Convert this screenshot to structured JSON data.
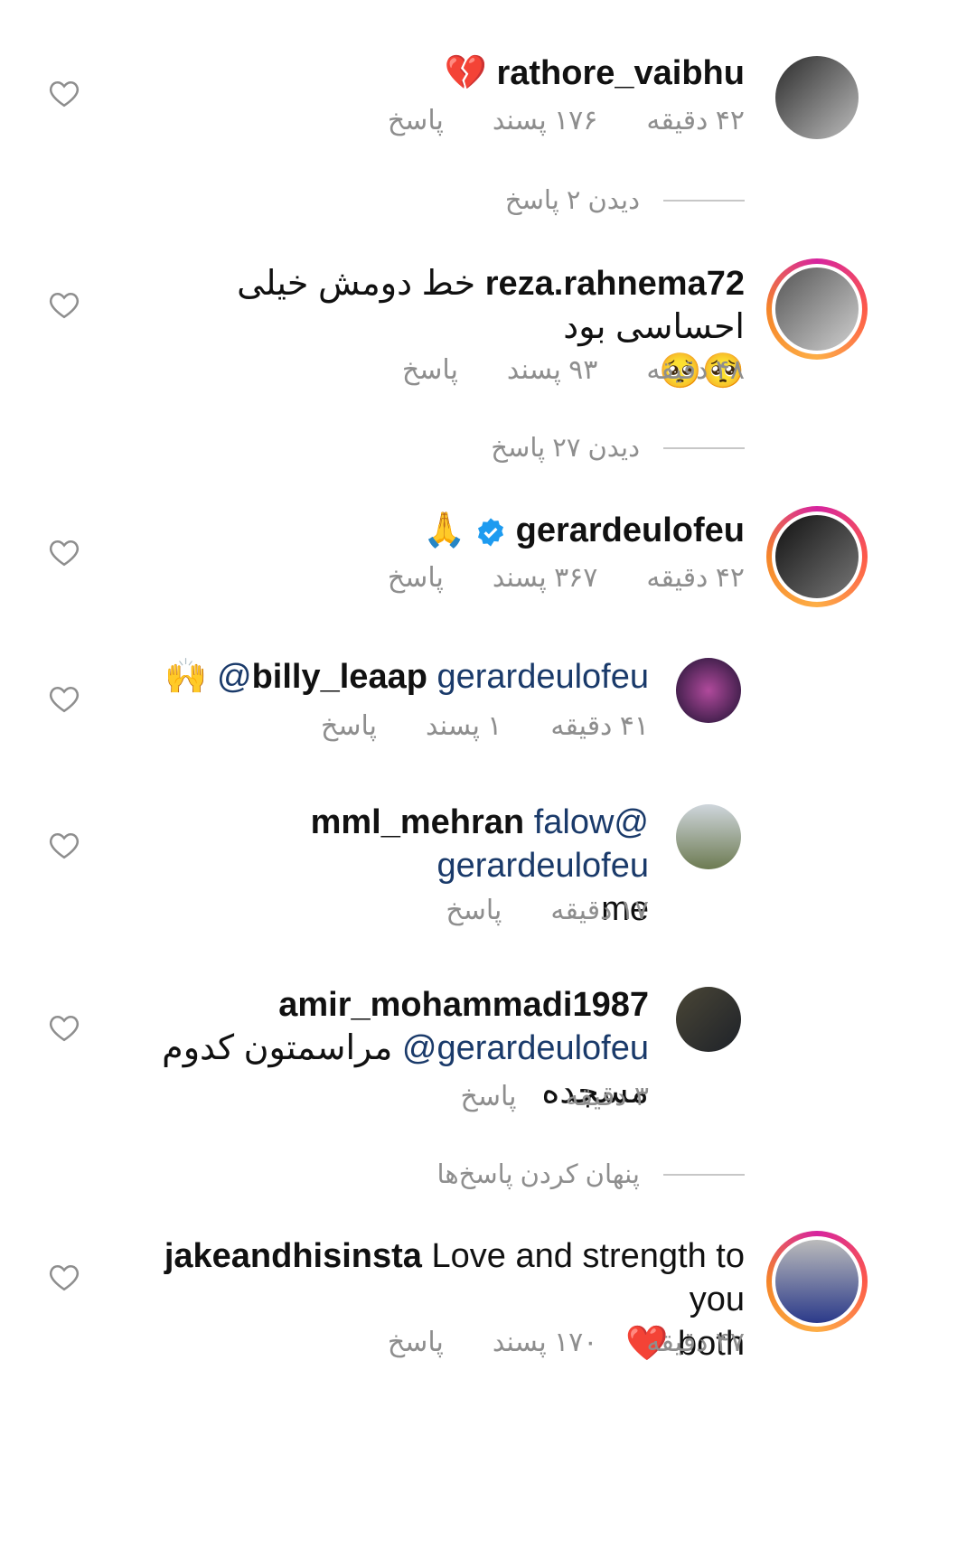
{
  "comments": [
    {
      "username": "rathore_vaibhu",
      "text": "💔",
      "time": "۴۲ دقیقه",
      "likes": "۱۷۶ پسند",
      "reply": "پاسخ",
      "toggle": "دیدن ۲ پاسخ"
    },
    {
      "username": "reza.rahnema72",
      "text": "خط دومش خیلی احساسی بود",
      "text2": "🥺🥺",
      "time": "۴۸ دقیقه",
      "likes": "۹۳ پسند",
      "reply": "پاسخ",
      "toggle": "دیدن ۲۷ پاسخ"
    },
    {
      "username": "gerardeulofeu",
      "text": "🙏",
      "time": "۴۲ دقیقه",
      "likes": "۳۶۷ پسند",
      "reply": "پاسخ"
    },
    {
      "username": "billy_leaap",
      "mention": "gerardeulofeu@",
      "text": "🙌",
      "time": "۴۱ دقیقه",
      "likes": "۱ پسند",
      "reply": "پاسخ"
    },
    {
      "username": "mml_mehran",
      "mention_a": "falow@",
      "mention_b": "gerardeulofeu",
      "text2": "me",
      "time": "۱۷ دقیقه",
      "reply": "پاسخ"
    },
    {
      "username": "amir_mohammadi1987",
      "mention": "gerardeulofeu@",
      "text": "مراسمتون کدوم مسجده",
      "time": "۳ دقیقه",
      "reply": "پاسخ",
      "toggle": "پنهان کردن پاسخ‌ها"
    },
    {
      "username": "jakeandhisinsta",
      "text": "Love and strength to you",
      "text2": "both",
      "emoji": "❤️",
      "time": "۴۷ دقیقه",
      "likes": "۱۷۰ پسند",
      "reply": "پاسخ"
    }
  ],
  "colors": {
    "meta": "#8e8e8e",
    "mention": "#1a3a6a",
    "verified": "#1d9bf0"
  },
  "icons": {
    "like": "heart-outline-icon",
    "verified": "verified-badge-icon"
  }
}
